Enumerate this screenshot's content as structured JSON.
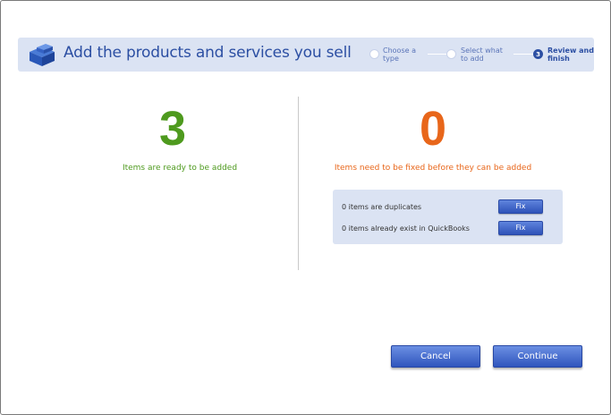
{
  "header": {
    "title": "Add the products and services you sell",
    "icon": "product-boxes-icon",
    "steps": [
      {
        "number": "",
        "label_line1": "Choose a",
        "label_line2": "type",
        "active": false
      },
      {
        "number": "",
        "label_line1": "Select what",
        "label_line2": "to add",
        "active": false
      },
      {
        "number": "3",
        "label_line1": "Review and",
        "label_line2": "finish",
        "active": true
      }
    ]
  },
  "ready": {
    "count": "3",
    "caption": "Items are ready to be added"
  },
  "fix": {
    "count": "0",
    "caption": "Items need to be fixed before they can be added",
    "rows": [
      {
        "text": "0 items are duplicates",
        "button_label": "Fix"
      },
      {
        "text": "0 items already exist in QuickBooks",
        "button_label": "Fix"
      }
    ]
  },
  "footer": {
    "cancel_label": "Cancel",
    "continue_label": "Continue"
  },
  "colors": {
    "accent_blue": "#2c4fa3",
    "ready_green": "#4e9a1e",
    "fix_orange": "#e8661a",
    "banner_bg": "#dbe3f3"
  }
}
